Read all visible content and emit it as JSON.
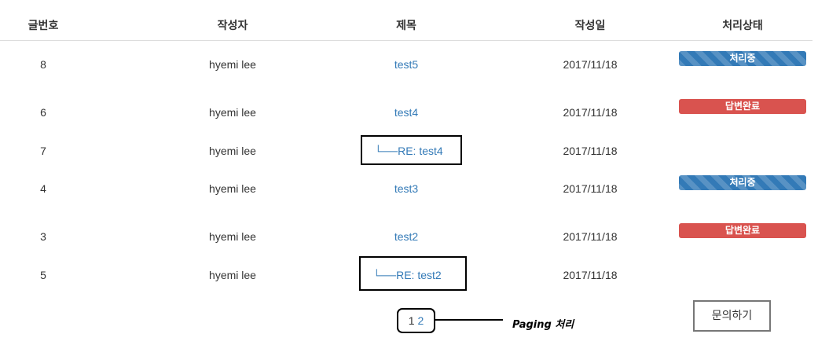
{
  "table": {
    "headers": [
      "글번호",
      "작성자",
      "제목",
      "작성일",
      "처리상태"
    ],
    "rows": [
      {
        "no": "8",
        "author": "hyemi lee",
        "title": "test5",
        "date": "2017/11/18",
        "status": "처리중"
      },
      {
        "no": "6",
        "author": "hyemi lee",
        "title": "test4",
        "date": "2017/11/18",
        "status": "답변완료"
      },
      {
        "no": "7",
        "author": "hyemi lee",
        "reply_prefix": "└──",
        "title": "RE: test4",
        "date": "2017/11/18"
      },
      {
        "no": "4",
        "author": "hyemi lee",
        "title": "test3",
        "date": "2017/11/18",
        "status": "처리중"
      },
      {
        "no": "3",
        "author": "hyemi lee",
        "title": "test2",
        "date": "2017/11/18",
        "status": "답변완료"
      },
      {
        "no": "5",
        "author": "hyemi lee",
        "reply_prefix": "└──",
        "title": "RE: test2",
        "date": "2017/11/18"
      }
    ]
  },
  "pagination": {
    "current": "1",
    "next": "2"
  },
  "annotation": {
    "paging_note": "Paging 처리"
  },
  "ask_button": {
    "label": "문의하기"
  },
  "colors": {
    "link": "#337ab7",
    "in_progress": "#337ab7",
    "done": "#d9534f"
  }
}
